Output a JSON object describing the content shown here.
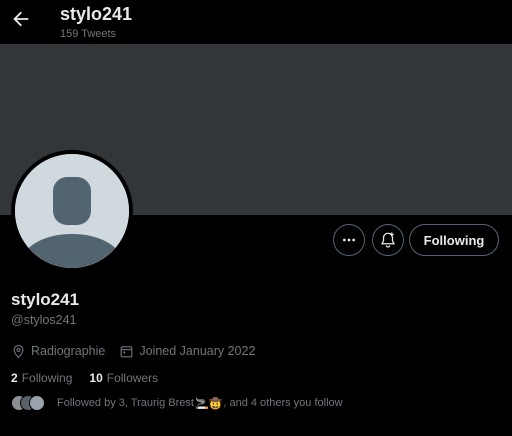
{
  "header": {
    "display_name": "stylo241",
    "tweet_count": "159 Tweets"
  },
  "actions": {
    "following_label": "Following"
  },
  "profile": {
    "display_name": "stylo241",
    "handle": "@stylos241",
    "location": "Radiographie",
    "joined": "Joined January 2022",
    "following_count": "2",
    "following_label": "Following",
    "followers_count": "10",
    "followers_label": "Followers",
    "followed_by_prefix": "Followed by 3, Traurig Brest",
    "followed_by_emoji": "🚬🤠",
    "followed_by_suffix": ", and 4 others you follow"
  },
  "icons": {
    "back": "arrow-left-icon",
    "more": "more-dots-icon",
    "notify": "bell-plus-icon",
    "location": "location-pin-icon",
    "calendar": "calendar-icon"
  },
  "colors": {
    "background": "#000000",
    "banner": "#333639",
    "avatar": "#cfd9de",
    "secondary_text": "#71767b",
    "primary_text": "#e7e9ea"
  }
}
